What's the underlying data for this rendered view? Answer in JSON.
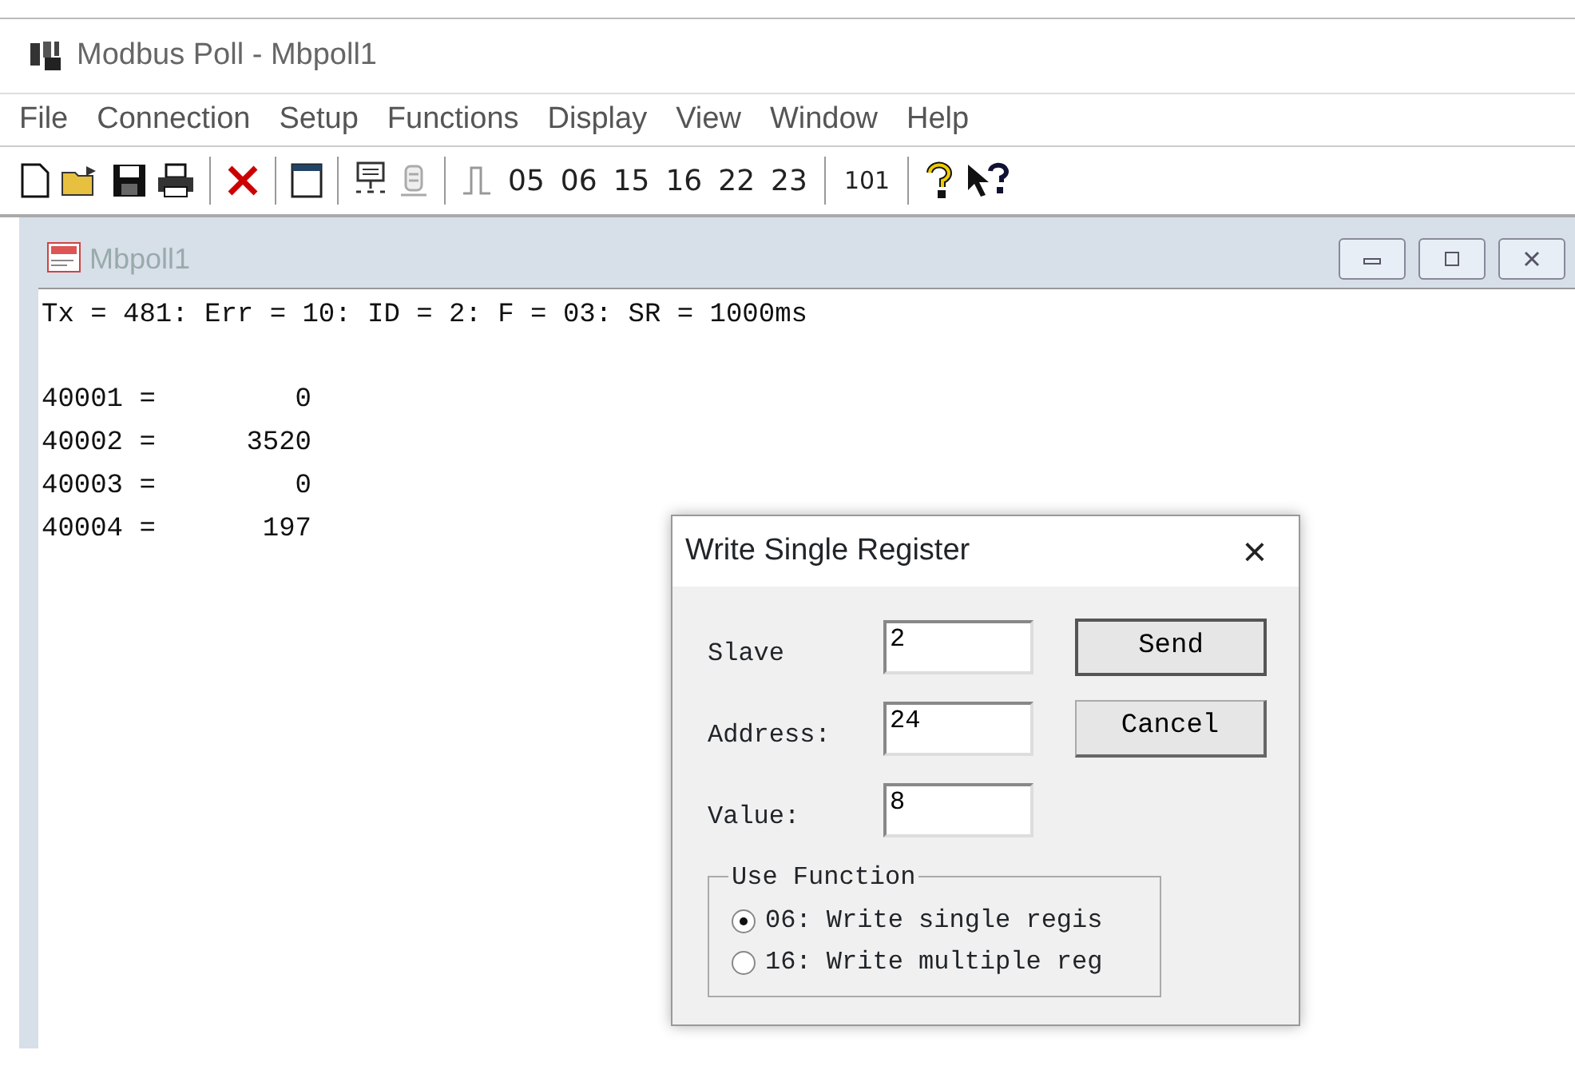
{
  "window": {
    "title": "Modbus Poll - Mbpoll1"
  },
  "menu": [
    "File",
    "Connection",
    "Setup",
    "Functions",
    "Display",
    "View",
    "Window",
    "Help"
  ],
  "toolbar": {
    "function_codes": [
      "05",
      "06",
      "15",
      "16",
      "22",
      "23"
    ],
    "register_button": "101"
  },
  "child_window": {
    "title": "Mbpoll1",
    "status_line": "Tx = 481: Err = 10: ID = 2: F = 03: SR = 1000ms",
    "registers": [
      {
        "address": "40001 =",
        "value": "0"
      },
      {
        "address": "40002 =",
        "value": "3520"
      },
      {
        "address": "40003 =",
        "value": "0"
      },
      {
        "address": "40004 =",
        "value": "197"
      }
    ]
  },
  "dialog": {
    "title": "Write Single Register",
    "close": "×",
    "fields": [
      {
        "label": "Slave",
        "value": "2"
      },
      {
        "label": "Address:",
        "value": "24"
      },
      {
        "label": "Value:",
        "value": "8"
      }
    ],
    "buttons": [
      "Send",
      "Cancel"
    ],
    "group": {
      "title": "Use Function",
      "options": [
        {
          "label": "06: Write single regis",
          "selected": true
        },
        {
          "label": "16: Write multiple reg",
          "selected": false
        }
      ]
    }
  }
}
